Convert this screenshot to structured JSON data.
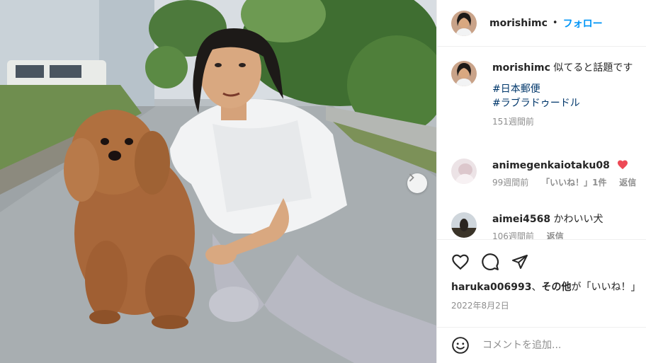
{
  "post": {
    "author": "morishimc",
    "separator": "•",
    "follow_label": "フォロー",
    "photo_alt": "A man in a white T-shirt kneeling next to a fluffy brown labradoodle dog on a road"
  },
  "caption": {
    "username": "morishimc",
    "text": "似てると話題です",
    "hashtags": [
      "#日本郵便",
      "#ラブラドゥードル"
    ],
    "time": "151週間前"
  },
  "comments": [
    {
      "username": "animegenkaiotaku08",
      "text": "",
      "emoji": "heart",
      "time": "99週間前",
      "likes_label": "「いいね！」1件",
      "reply_label": "返信"
    },
    {
      "username": "aimei4568",
      "text": "かわいい犬",
      "time": "106週間前",
      "reply_label": "返信"
    }
  ],
  "likes": {
    "user": "haruka006993",
    "connector": "、",
    "others": "その他",
    "suffix": "が「いいね！」"
  },
  "date": "2022年8月2日",
  "comment_input": {
    "placeholder": "コメントを追加..."
  },
  "colors": {
    "link_blue": "#0095f6",
    "hashtag": "#00376b",
    "muted": "#8e8e8e",
    "heart": "#ed4956"
  }
}
